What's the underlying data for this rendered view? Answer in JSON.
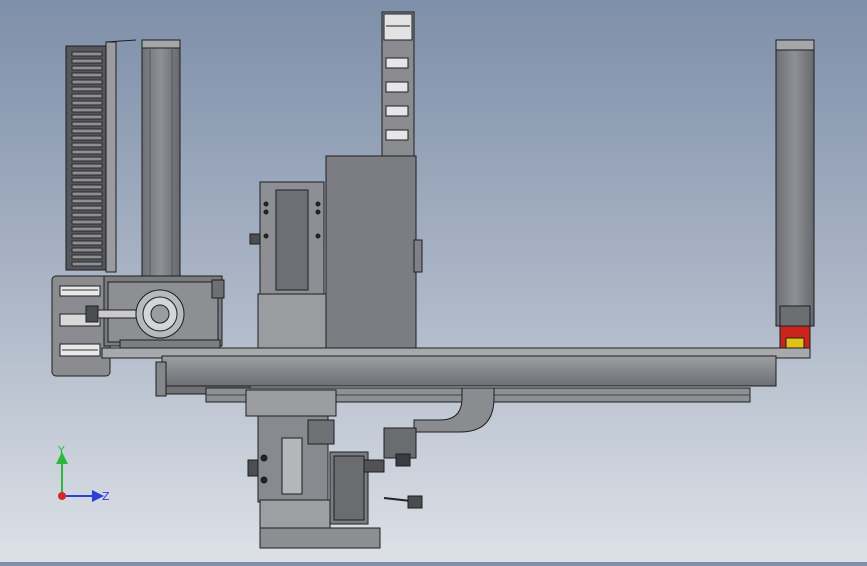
{
  "triad": {
    "y_label": "Y",
    "z_label": "Z",
    "y_color": "#2db83d",
    "z_color": "#2f3fd6",
    "x_color": "#d62828"
  },
  "palette": {
    "metal_dark": "#5f6166",
    "metal_mid": "#7b7d82",
    "metal_light": "#a9abaf",
    "edge": "#1e1e20",
    "stop_red": "#c8261c",
    "stop_yellow": "#e0c21a"
  }
}
